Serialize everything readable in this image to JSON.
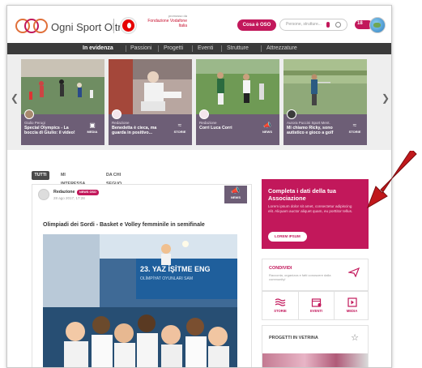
{
  "header": {
    "brand": "Ogni Sport Oltre",
    "foundation_small": "promosso da",
    "foundation_name": "Fondazione Vodafone Italia",
    "cta_label": "Cosa è OSO",
    "search_placeholder": "Persone, strutture...",
    "notifications_count": "18"
  },
  "nav": {
    "items": [
      "In evidenza",
      "Passioni",
      "Progetti",
      "Eventi",
      "Strutture",
      "Attrezzature"
    ]
  },
  "carousel": {
    "cards": [
      {
        "author": "Giulio Perugi",
        "title": "Special Olympics - La boccia di Giulio: il video!",
        "type": "MEDIA"
      },
      {
        "author": "Redazione",
        "title": "Benedetta è cieca, ma guarda in positivo...",
        "type": "STORIE"
      },
      {
        "author": "Redazione",
        "title": "Corri Luca Corri",
        "type": "NEWS"
      },
      {
        "author": "Aurora Puccini Sport Ment.",
        "title": "Mi chiamo Ricky, sono autistico e gioco a golf",
        "type": "STORIE"
      }
    ]
  },
  "tabs": [
    "TUTTI",
    "MI INTERESSA",
    "DA CHI SEGUO"
  ],
  "post": {
    "author": "Redazione",
    "badge": "NEWS OSO",
    "date": "28 ago 2017, 17:28",
    "type": "NEWS",
    "title": "Olimpiadi dei Sordi - Basket e Volley femminile in semifinale",
    "banner_text": "23. YAZ İŞİTME ENG",
    "banner_sub": "OLİMPİYAT OYUNLARI SAM"
  },
  "sidebar": {
    "promo_title": "Completa i dati della tua Associazione",
    "promo_text": "Lorem ipsum dolor sit amet, consectetur adipiscing elit. Aliquam auctor aliquet quam, eu porttitor tellus.",
    "promo_button": "LOREM IPSUM",
    "share_title": "CONDIVIDI",
    "share_text": "Racconta, organizza e fatti conoscere dalla community!",
    "quick": [
      "STORIE",
      "EVENTI",
      "MEDIA"
    ],
    "vetrina_title": "PROGETTI IN VETRINA"
  },
  "colors": {
    "accent": "#c2185b",
    "nav_bg": "#3a3a3a",
    "card_info": "#6d5e76",
    "annotation_arrow": "#c0181b"
  }
}
